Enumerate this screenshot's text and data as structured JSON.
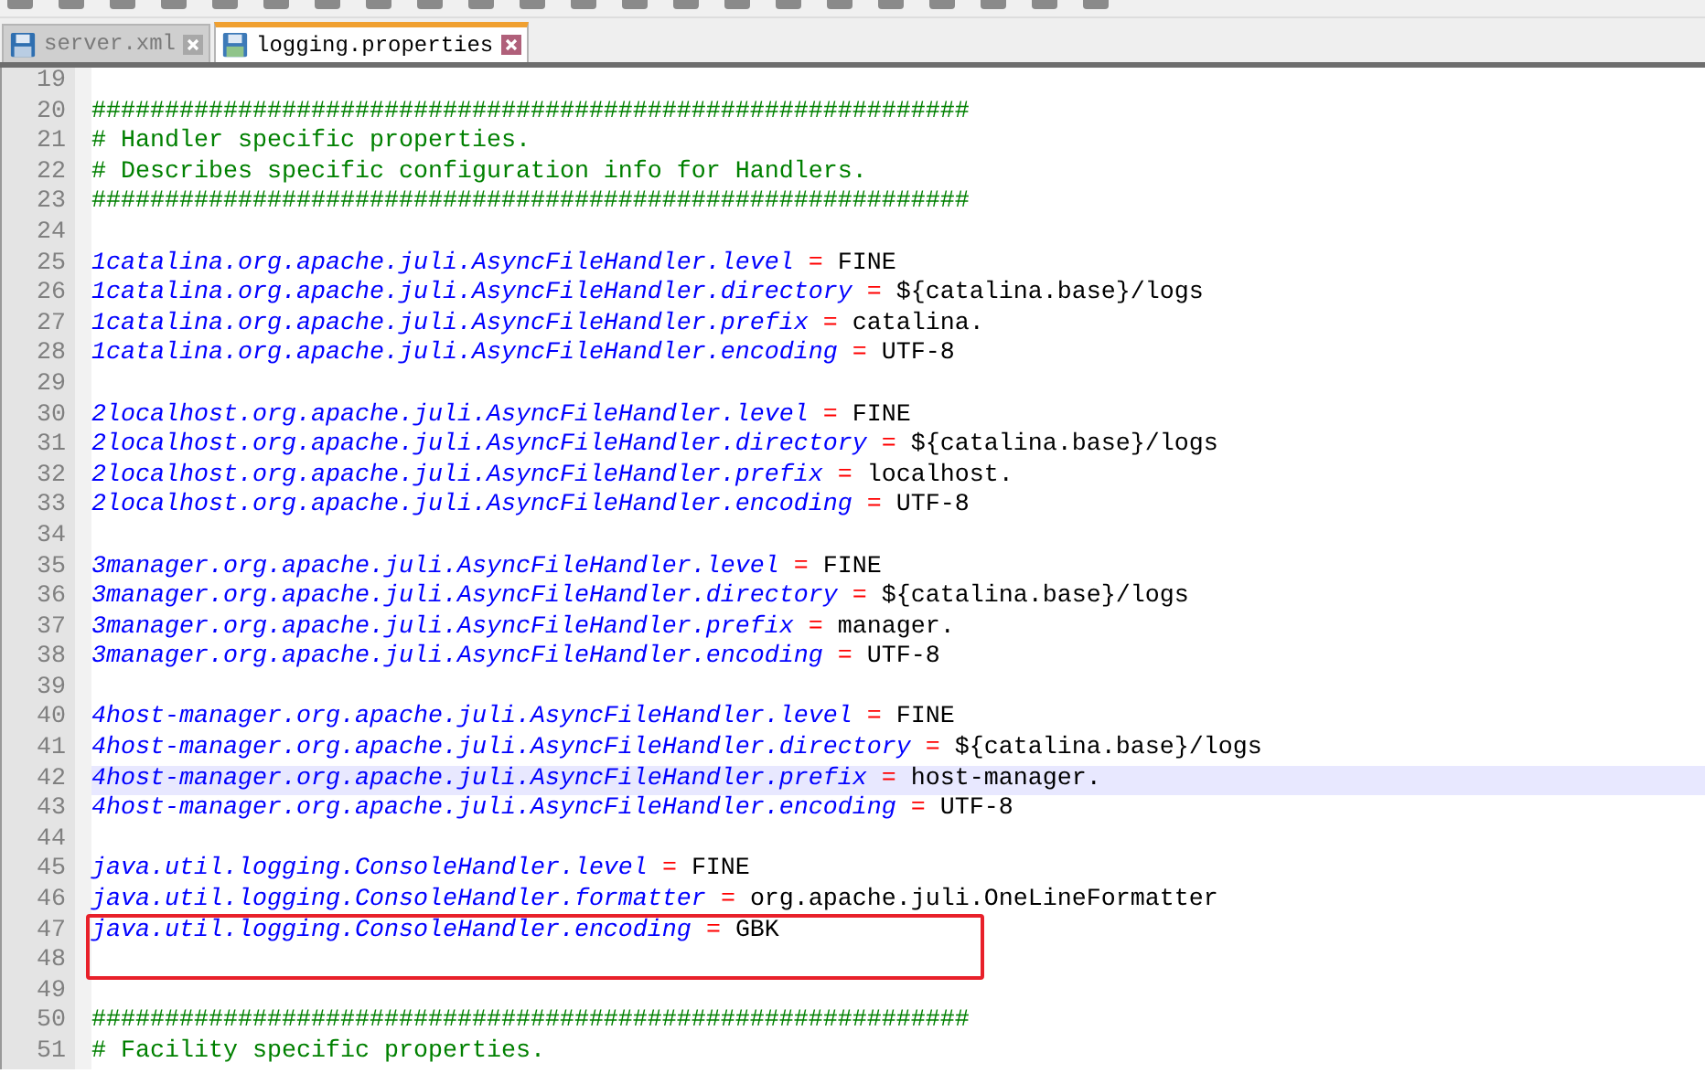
{
  "tabs": [
    {
      "label": "server.xml",
      "selected": false
    },
    {
      "label": "logging.properties",
      "selected": true
    }
  ],
  "editor": {
    "lines": [
      {
        "number": "19",
        "kind": "blank",
        "current": false,
        "boxed": false
      },
      {
        "number": "20",
        "kind": "comment",
        "text": "############################################################",
        "current": false,
        "boxed": false
      },
      {
        "number": "21",
        "kind": "comment",
        "text": "# Handler specific properties.",
        "current": false,
        "boxed": false
      },
      {
        "number": "22",
        "kind": "comment",
        "text": "# Describes specific configuration info for Handlers.",
        "current": false,
        "boxed": false
      },
      {
        "number": "23",
        "kind": "comment",
        "text": "############################################################",
        "current": false,
        "boxed": false
      },
      {
        "number": "24",
        "kind": "blank",
        "current": false,
        "boxed": false
      },
      {
        "number": "25",
        "kind": "property",
        "key": "1catalina.org.apache.juli.AsyncFileHandler.level",
        "op": "=",
        "value": "FINE",
        "current": false,
        "boxed": false
      },
      {
        "number": "26",
        "kind": "property",
        "key": "1catalina.org.apache.juli.AsyncFileHandler.directory",
        "op": "=",
        "value": "${catalina.base}/logs",
        "current": false,
        "boxed": false
      },
      {
        "number": "27",
        "kind": "property",
        "key": "1catalina.org.apache.juli.AsyncFileHandler.prefix",
        "op": "=",
        "value": "catalina.",
        "current": false,
        "boxed": false
      },
      {
        "number": "28",
        "kind": "property",
        "key": "1catalina.org.apache.juli.AsyncFileHandler.encoding",
        "op": "=",
        "value": "UTF-8",
        "current": false,
        "boxed": false
      },
      {
        "number": "29",
        "kind": "blank",
        "current": false,
        "boxed": false
      },
      {
        "number": "30",
        "kind": "property",
        "key": "2localhost.org.apache.juli.AsyncFileHandler.level",
        "op": "=",
        "value": "FINE",
        "current": false,
        "boxed": false
      },
      {
        "number": "31",
        "kind": "property",
        "key": "2localhost.org.apache.juli.AsyncFileHandler.directory",
        "op": "=",
        "value": "${catalina.base}/logs",
        "current": false,
        "boxed": false
      },
      {
        "number": "32",
        "kind": "property",
        "key": "2localhost.org.apache.juli.AsyncFileHandler.prefix",
        "op": "=",
        "value": "localhost.",
        "current": false,
        "boxed": false
      },
      {
        "number": "33",
        "kind": "property",
        "key": "2localhost.org.apache.juli.AsyncFileHandler.encoding",
        "op": "=",
        "value": "UTF-8",
        "current": false,
        "boxed": false
      },
      {
        "number": "34",
        "kind": "blank",
        "current": false,
        "boxed": false
      },
      {
        "number": "35",
        "kind": "property",
        "key": "3manager.org.apache.juli.AsyncFileHandler.level",
        "op": "=",
        "value": "FINE",
        "current": false,
        "boxed": false
      },
      {
        "number": "36",
        "kind": "property",
        "key": "3manager.org.apache.juli.AsyncFileHandler.directory",
        "op": "=",
        "value": "${catalina.base}/logs",
        "current": false,
        "boxed": false
      },
      {
        "number": "37",
        "kind": "property",
        "key": "3manager.org.apache.juli.AsyncFileHandler.prefix",
        "op": "=",
        "value": "manager.",
        "current": false,
        "boxed": false
      },
      {
        "number": "38",
        "kind": "property",
        "key": "3manager.org.apache.juli.AsyncFileHandler.encoding",
        "op": "=",
        "value": "UTF-8",
        "current": false,
        "boxed": false
      },
      {
        "number": "39",
        "kind": "blank",
        "current": false,
        "boxed": false
      },
      {
        "number": "40",
        "kind": "property",
        "key": "4host-manager.org.apache.juli.AsyncFileHandler.level",
        "op": "=",
        "value": "FINE",
        "current": false,
        "boxed": false
      },
      {
        "number": "41",
        "kind": "property",
        "key": "4host-manager.org.apache.juli.AsyncFileHandler.directory",
        "op": "=",
        "value": "${catalina.base}/logs",
        "current": false,
        "boxed": false
      },
      {
        "number": "42",
        "kind": "property",
        "key": "4host-manager.org.apache.juli.AsyncFileHandler.prefix",
        "op": "=",
        "value": "host-manager.",
        "current": true,
        "boxed": false
      },
      {
        "number": "43",
        "kind": "property",
        "key": "4host-manager.org.apache.juli.AsyncFileHandler.encoding",
        "op": "=",
        "value": "UTF-8",
        "current": false,
        "boxed": false
      },
      {
        "number": "44",
        "kind": "blank",
        "current": false,
        "boxed": false
      },
      {
        "number": "45",
        "kind": "property",
        "key": "java.util.logging.ConsoleHandler.level",
        "op": "=",
        "value": "FINE",
        "current": false,
        "boxed": false
      },
      {
        "number": "46",
        "kind": "property",
        "key": "java.util.logging.ConsoleHandler.formatter",
        "op": "=",
        "value": "org.apache.juli.OneLineFormatter",
        "current": false,
        "boxed": false
      },
      {
        "number": "47",
        "kind": "property",
        "key": "java.util.logging.ConsoleHandler.encoding",
        "op": "=",
        "value": "GBK",
        "current": false,
        "boxed": true
      },
      {
        "number": "48",
        "kind": "blank",
        "current": false,
        "boxed": true
      },
      {
        "number": "49",
        "kind": "blank",
        "current": false,
        "boxed": false
      },
      {
        "number": "50",
        "kind": "comment",
        "text": "############################################################",
        "current": false,
        "boxed": false
      },
      {
        "number": "51",
        "kind": "comment",
        "text": "# Facility specific properties.",
        "current": false,
        "boxed": false
      }
    ]
  }
}
